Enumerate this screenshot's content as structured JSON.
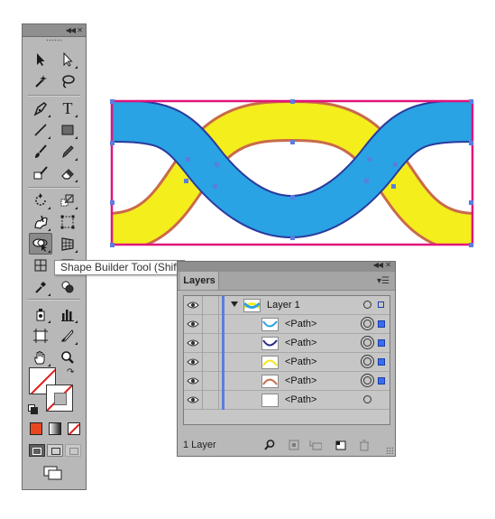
{
  "tooltip": {
    "text": "Shape Builder Tool (Shift+M)"
  },
  "toolbox": {
    "tools": [
      {
        "name": "selection-tool"
      },
      {
        "name": "direct-selection-tool"
      },
      {
        "name": "magic-wand-tool"
      },
      {
        "name": "lasso-tool"
      },
      {
        "name": "pen-tool"
      },
      {
        "name": "type-tool",
        "glyph": "T"
      },
      {
        "name": "line-segment-tool"
      },
      {
        "name": "rectangle-tool"
      },
      {
        "name": "paintbrush-tool"
      },
      {
        "name": "pencil-tool"
      },
      {
        "name": "blob-brush-tool"
      },
      {
        "name": "eraser-tool"
      },
      {
        "name": "rotate-tool"
      },
      {
        "name": "scale-tool"
      },
      {
        "name": "warp-tool"
      },
      {
        "name": "free-transform-tool"
      },
      {
        "name": "shape-builder-tool",
        "selected": true
      },
      {
        "name": "perspective-grid-tool"
      },
      {
        "name": "eyedropper-tool"
      },
      {
        "name": "blend-tool"
      },
      {
        "name": "symbol-sprayer-tool"
      },
      {
        "name": "column-graph-tool"
      },
      {
        "name": "artboard-tool"
      },
      {
        "name": "slice-tool"
      },
      {
        "name": "hand-tool"
      },
      {
        "name": "zoom-tool"
      }
    ],
    "fill_color": "#ffffff",
    "stroke_color": "#ffffff"
  },
  "layers_panel": {
    "tab_label": "Layers",
    "layer_count": "1 Layer",
    "rows": [
      {
        "name": "Layer 1",
        "type": "layer",
        "expanded": true,
        "target_selected": false,
        "selected": true
      },
      {
        "name": "<Path>",
        "type": "path",
        "thumb_color": "#29a3e3",
        "target_selected": true,
        "selected": true
      },
      {
        "name": "<Path>",
        "type": "path",
        "thumb_color": "#2a2a8a",
        "target_selected": true,
        "selected": true
      },
      {
        "name": "<Path>",
        "type": "path",
        "thumb_color": "#f4e81c",
        "target_selected": true,
        "selected": true
      },
      {
        "name": "<Path>",
        "type": "path",
        "thumb_color": "#c96a4a",
        "target_selected": true,
        "selected": true
      },
      {
        "name": "<Path>",
        "type": "path",
        "thumb_color": "#ffffff",
        "target_selected": false,
        "selected": false
      }
    ]
  },
  "colors": {
    "cyan_band": "#29a3e3",
    "cyan_outline": "#2a3a9c",
    "yellow_band": "#f4ee1c",
    "yellow_outline": "#c96a4a",
    "artboard_frame": "#e0157c",
    "selection_anchor": "#5a7de0"
  }
}
